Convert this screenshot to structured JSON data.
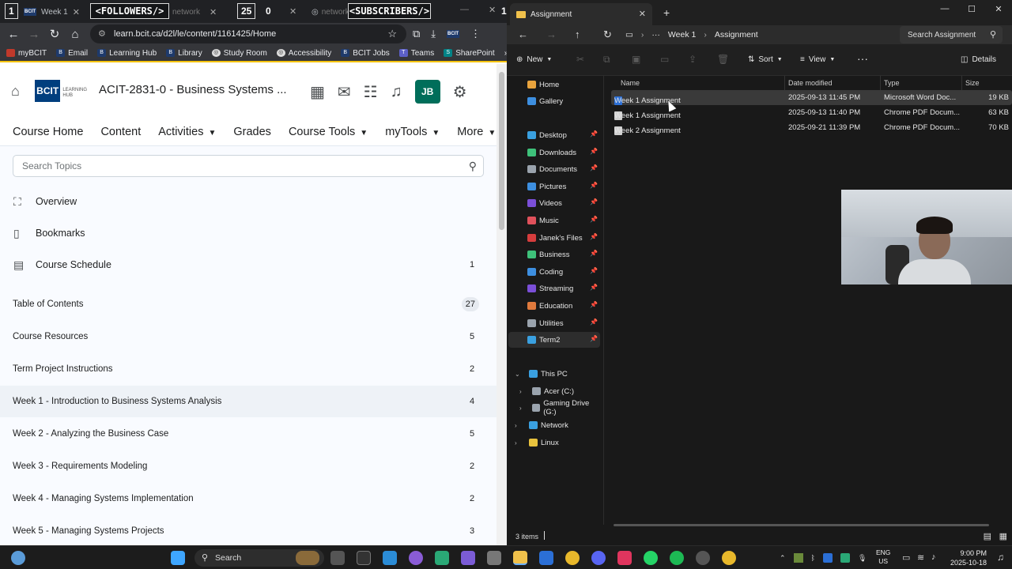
{
  "browser": {
    "tabs": [
      {
        "label": "Week 1"
      },
      {
        "label": "network"
      },
      {
        "label": "network"
      }
    ],
    "overlays": {
      "followers": "<FOLLOWERS/>",
      "followers_count": "25",
      "subscribers": "<SUBSCRIBERS/>",
      "subscribers_count": "1",
      "zero": "0",
      "one_left": "1"
    },
    "url": "learn.bcit.ca/d2l/le/content/1161425/Home",
    "bookmarks": [
      "myBCIT",
      "Email",
      "Learning Hub",
      "Library",
      "Study Room",
      "Accessibility",
      "BCIT Jobs",
      "Teams",
      "SharePoint"
    ]
  },
  "d2l": {
    "logo_text": "BCIT",
    "logo_sub1": "LEARNING",
    "logo_sub2": "HUB",
    "course_title": "ACIT-2831-0 - Business Systems ...",
    "avatar": "JB",
    "nav": [
      {
        "label": "Course Home",
        "dropdown": false
      },
      {
        "label": "Content",
        "dropdown": false
      },
      {
        "label": "Activities",
        "dropdown": true
      },
      {
        "label": "Grades",
        "dropdown": false
      },
      {
        "label": "Course Tools",
        "dropdown": true
      },
      {
        "label": "myTools",
        "dropdown": true
      },
      {
        "label": "More",
        "dropdown": true
      }
    ],
    "search_placeholder": "Search Topics",
    "toc": [
      {
        "label": "Overview",
        "count": "",
        "icon": "overview"
      },
      {
        "label": "Bookmarks",
        "count": "",
        "icon": "bookmark"
      },
      {
        "label": "Course Schedule",
        "count": "1",
        "icon": "calendar"
      },
      {
        "label": "Table of Contents",
        "count": "27"
      },
      {
        "label": "Course Resources",
        "count": "5"
      },
      {
        "label": "Term Project Instructions",
        "count": "2"
      },
      {
        "label": "Week 1 - Introduction to Business Systems Analysis",
        "count": "4"
      },
      {
        "label": "Week 2 - Analyzing the Business Case",
        "count": "5"
      },
      {
        "label": "Week 3 - Requirements Modeling",
        "count": "2"
      },
      {
        "label": "Week 4 - Managing Systems Implementation",
        "count": "2"
      },
      {
        "label": "Week 5 - Managing Systems Projects",
        "count": "3"
      }
    ]
  },
  "explorer": {
    "tab_title": "Assignment",
    "breadcrumb": [
      "Week 1",
      "Assignment"
    ],
    "search_placeholder": "Search Assignment",
    "cmd": {
      "new": "New",
      "sort": "Sort",
      "view": "View",
      "details": "Details"
    },
    "sidebar": [
      {
        "label": "Home",
        "color": "#e8a33d"
      },
      {
        "label": "Gallery",
        "color": "#3d8fe0"
      },
      {
        "label": "Desktop",
        "color": "#3aa0e0",
        "pinned": true
      },
      {
        "label": "Downloads",
        "color": "#3ec17a",
        "pinned": true
      },
      {
        "label": "Documents",
        "color": "#9aa3ad",
        "pinned": true
      },
      {
        "label": "Pictures",
        "color": "#3d8fe0",
        "pinned": true
      },
      {
        "label": "Videos",
        "color": "#7b4fd8",
        "pinned": true
      },
      {
        "label": "Music",
        "color": "#e0515b",
        "pinned": true
      },
      {
        "label": "Janek's Files",
        "color": "#d63d3d",
        "pinned": true
      },
      {
        "label": "Business",
        "color": "#3ec17a",
        "pinned": true
      },
      {
        "label": "Coding",
        "color": "#3d8fe0",
        "pinned": true
      },
      {
        "label": "Streaming",
        "color": "#7b4fd8",
        "pinned": true
      },
      {
        "label": "Education",
        "color": "#e07a3d",
        "pinned": true
      },
      {
        "label": "Utilities",
        "color": "#9aa3ad",
        "pinned": true
      },
      {
        "label": "Term2",
        "color": "#3aa0e0",
        "pinned": true
      }
    ],
    "tree": [
      {
        "label": "This PC",
        "color": "#3aa0e0"
      },
      {
        "label": "Acer (C:)",
        "color": "#9aa3ad"
      },
      {
        "label": "Gaming Drive (G:)",
        "color": "#9aa3ad"
      },
      {
        "label": "Network",
        "color": "#3aa0e0"
      },
      {
        "label": "Linux",
        "color": "#e8c23d"
      }
    ],
    "columns": [
      "Name",
      "Date modified",
      "Type",
      "Size"
    ],
    "files": [
      {
        "name": "Week 1 Assignment",
        "date": "2025-09-13 11:45 PM",
        "type": "Microsoft Word Doc...",
        "size": "19 KB",
        "kind": "word"
      },
      {
        "name": "Week 1 Assignment",
        "date": "2025-09-13 11:40 PM",
        "type": "Chrome PDF Docum...",
        "size": "63 KB",
        "kind": "pdf"
      },
      {
        "name": "Week 2 Assignment",
        "date": "2025-09-21 11:39 PM",
        "type": "Chrome PDF Docum...",
        "size": "70 KB",
        "kind": "pdf"
      }
    ],
    "status": "3 items"
  },
  "taskbar": {
    "search": "Search",
    "lang1": "ENG",
    "lang2": "US",
    "time": "9:00 PM",
    "date": "2025-10-18"
  }
}
